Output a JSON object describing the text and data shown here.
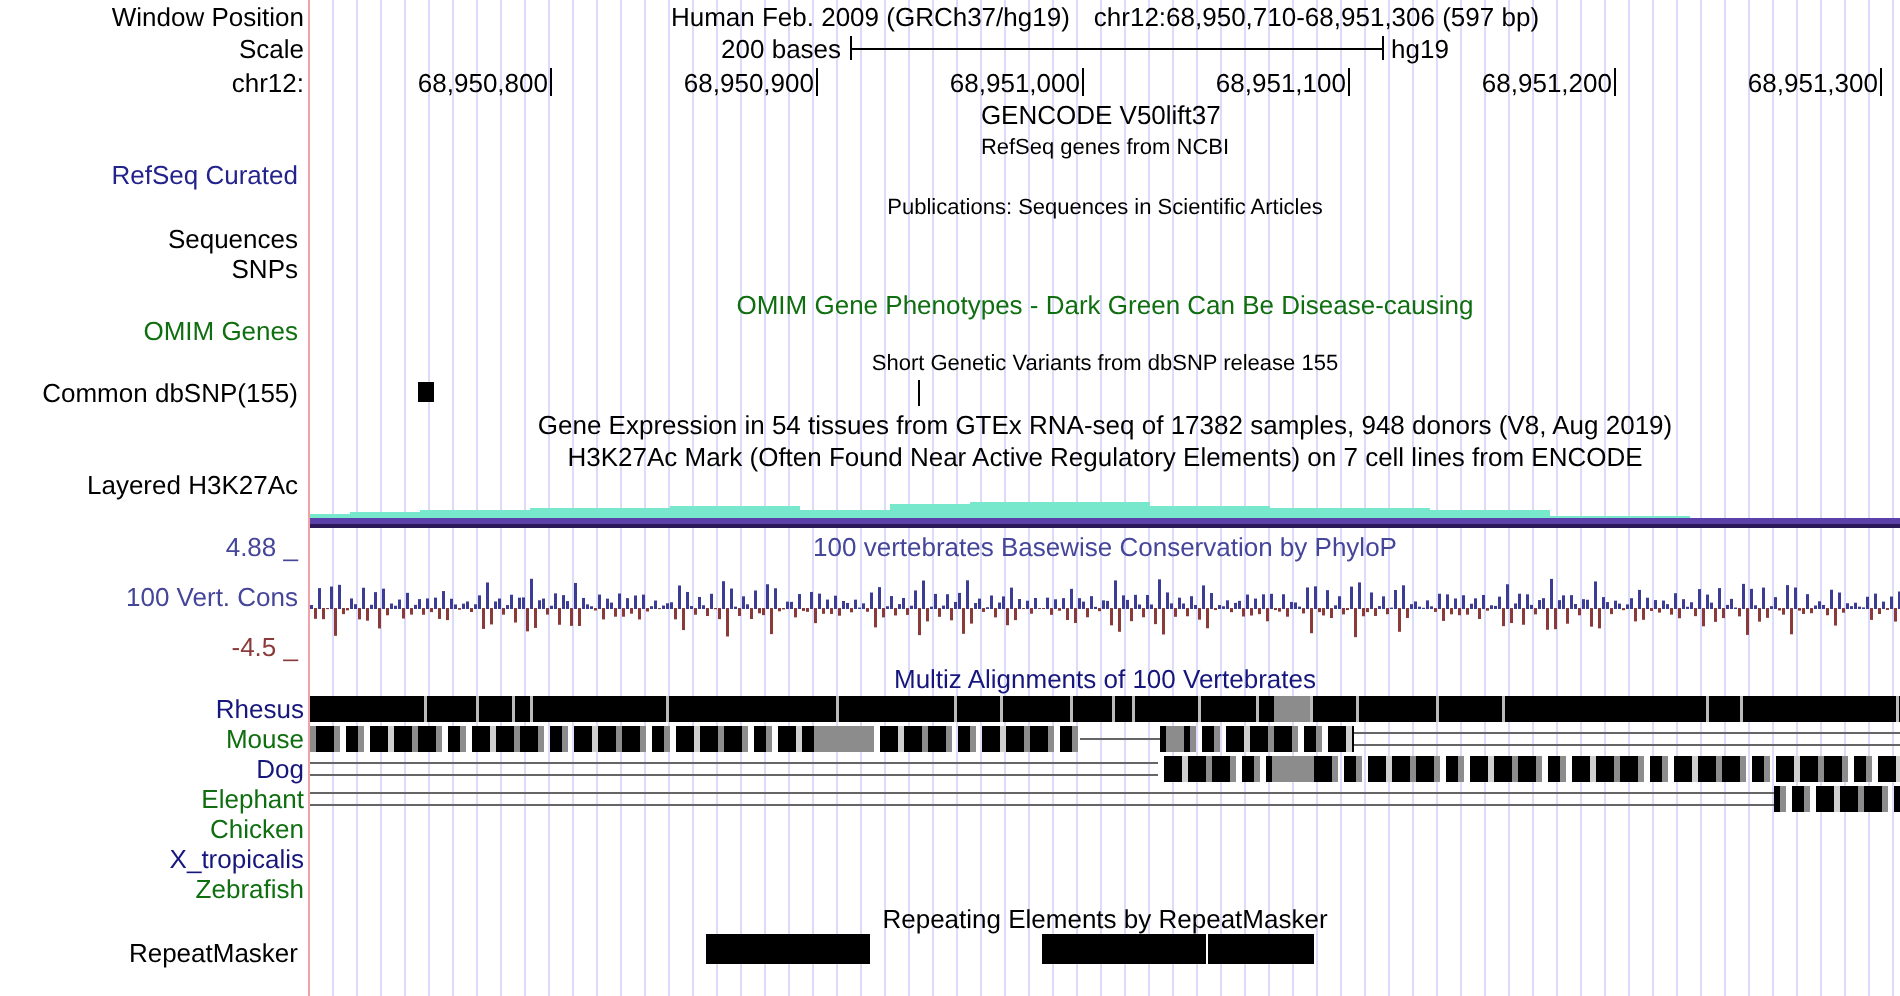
{
  "header": {
    "position_label": "Window Position",
    "assembly_title": "Human Feb. 2009 (GRCh37/hg19)",
    "position": "chr12:68,950,710-68,951,306 (597 bp)",
    "scale_label": "Scale",
    "scale_text": "200 bases",
    "scale_assembly": "hg19",
    "chrom_label": "chr12:",
    "ruler_ticks": [
      "68,950,800",
      "68,950,900",
      "68,951,000",
      "68,951,100",
      "68,951,200",
      "68,951,300"
    ]
  },
  "tracks": [
    {
      "kind": "genes",
      "titles": [
        {
          "text": "GENCODE V50lift37",
          "color": "#000000"
        },
        {
          "text": "RefSeq genes from NCBI",
          "color": "#000000"
        }
      ],
      "labels": [
        {
          "text": "RefSeq Curated",
          "color": "#23238c"
        }
      ]
    },
    {
      "kind": "publications",
      "titles": [
        {
          "text": "Publications: Sequences in Scientific Articles",
          "color": "#000000"
        }
      ],
      "labels": [
        {
          "text": "Sequences",
          "color": "#000000"
        },
        {
          "text": "SNPs",
          "color": "#000000"
        }
      ]
    },
    {
      "kind": "omim",
      "titles": [
        {
          "text": "OMIM Gene Phenotypes - Dark Green Can Be Disease-causing",
          "color": "#0f6e0f"
        }
      ],
      "labels": [
        {
          "text": "OMIM Genes",
          "color": "#0f6e0f"
        }
      ]
    },
    {
      "kind": "snp",
      "titles": [
        {
          "text": "Short Genetic Variants from dbSNP release 155",
          "color": "#000000"
        }
      ],
      "labels": [
        {
          "text": "Common dbSNP(155)",
          "color": "#000000"
        }
      ]
    },
    {
      "kind": "expression",
      "titles": [
        {
          "text": "Gene Expression in 54 tissues from GTEx RNA-seq of 17382 samples, 948 donors (V8, Aug 2019)",
          "color": "#000000"
        },
        {
          "text": "H3K27Ac Mark (Often Found Near Active Regulatory Elements) on 7 cell lines from ENCODE",
          "color": "#000000"
        }
      ],
      "labels": [
        {
          "text": "Layered H3K27Ac",
          "color": "#000000"
        }
      ]
    },
    {
      "kind": "conservation",
      "titles": [
        {
          "text": "100 vertebrates Basewise Conservation by PhyloP",
          "color": "#45459a"
        }
      ],
      "labels": [
        {
          "text": "4.88 _",
          "color": "#45459a"
        },
        {
          "text": "100 Vert. Cons",
          "color": "#45459a"
        },
        {
          "text": "-4.5 _",
          "color": "#8b3a3a"
        }
      ]
    },
    {
      "kind": "multiz",
      "titles": [
        {
          "text": "Multiz Alignments of 100 Vertebrates",
          "color": "#16167c"
        }
      ],
      "labels": [
        {
          "text": "Rhesus",
          "color": "#16167c"
        },
        {
          "text": "Mouse",
          "color": "#0f6e0f"
        },
        {
          "text": "Dog",
          "color": "#16167c"
        },
        {
          "text": "Elephant",
          "color": "#0f6e0f"
        },
        {
          "text": "Chicken",
          "color": "#0f6e0f"
        },
        {
          "text": "X_tropicalis",
          "color": "#16167c"
        },
        {
          "text": "Zebrafish",
          "color": "#0f6e0f"
        }
      ]
    },
    {
      "kind": "repeat",
      "titles": [
        {
          "text": "Repeating Elements by RepeatMasker",
          "color": "#000000"
        }
      ],
      "labels": [
        {
          "text": "RepeatMasker",
          "color": "#000000"
        }
      ]
    }
  ]
}
